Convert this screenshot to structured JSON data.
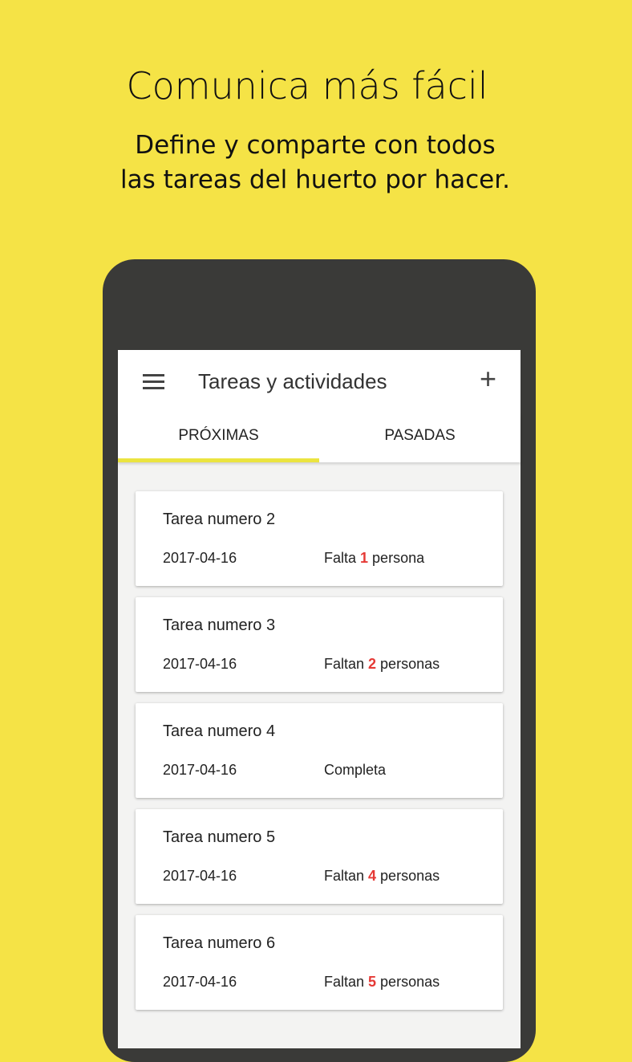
{
  "promo": {
    "headline": "Comunica más fácil",
    "line1": "Define y comparte con todos",
    "line2": "las tareas del huerto por hacer."
  },
  "app": {
    "title": "Tareas y actividades",
    "menu_icon": "hamburger-menu-icon",
    "add_icon": "plus-icon",
    "tabs": [
      {
        "label": "PRÓXIMAS",
        "active": true
      },
      {
        "label": "PASADAS",
        "active": false
      }
    ],
    "accent": "#ebe440",
    "highlight": "#e53935",
    "tasks": [
      {
        "title": "Tarea numero 2",
        "date": "2017-04-16",
        "status_pre": "Falta ",
        "count": "1",
        "status_post": " persona"
      },
      {
        "title": "Tarea numero 3",
        "date": "2017-04-16",
        "status_pre": "Faltan ",
        "count": "2",
        "status_post": " personas"
      },
      {
        "title": "Tarea numero 4",
        "date": "2017-04-16",
        "status_pre": "Completa",
        "count": "",
        "status_post": ""
      },
      {
        "title": "Tarea numero 5",
        "date": "2017-04-16",
        "status_pre": "Faltan ",
        "count": "4",
        "status_post": " personas"
      },
      {
        "title": "Tarea numero 6",
        "date": "2017-04-16",
        "status_pre": "Faltan ",
        "count": "5",
        "status_post": " personas"
      }
    ]
  }
}
